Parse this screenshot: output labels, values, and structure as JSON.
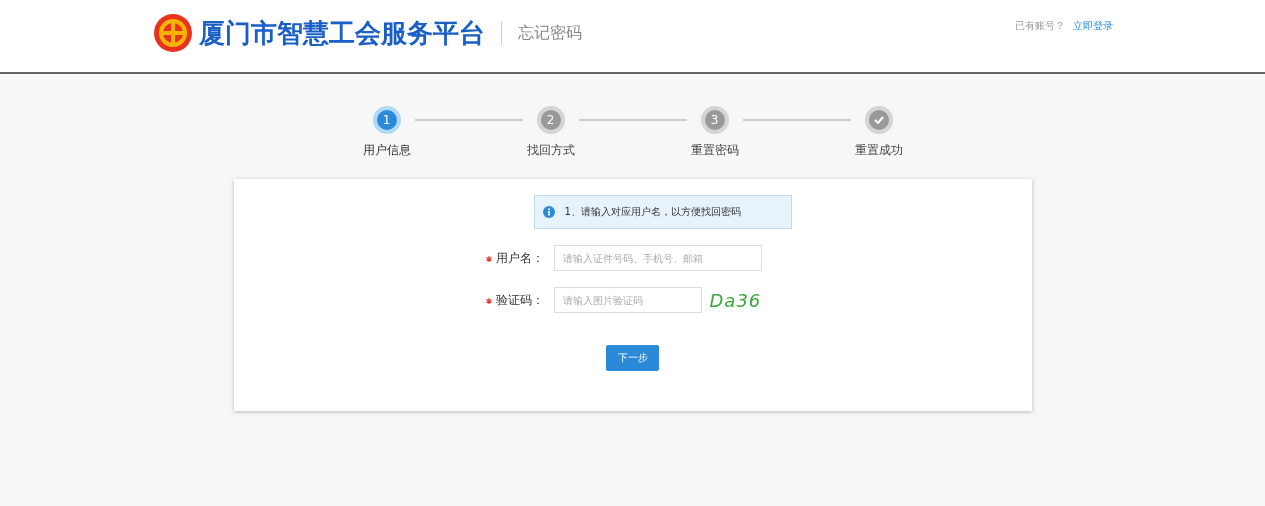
{
  "header": {
    "site_title": "厦门市智慧工会服务平台",
    "page_title": "忘记密码",
    "account_prompt": "已有账号？",
    "login_link": "立即登录"
  },
  "steps": [
    {
      "kind": "number",
      "mark": "1",
      "label": "用户信息",
      "selected": true
    },
    {
      "kind": "number",
      "mark": "2",
      "label": "找回方式",
      "selected": false
    },
    {
      "kind": "number",
      "mark": "3",
      "label": "重置密码",
      "selected": false
    },
    {
      "kind": "check",
      "label": "重置成功",
      "selected": false
    }
  ],
  "notice": "1、请输入对应用户名，以方便找回密码",
  "fields": [
    {
      "kind": "text",
      "required": true,
      "label": "用户名：",
      "placeholder": "请输入证件号码、手机号、邮箱"
    },
    {
      "kind": "captcha",
      "required": true,
      "label": "验证码：",
      "placeholder": "请输入图片验证码",
      "captcha": "Da36"
    }
  ],
  "next_button": "下一步"
}
